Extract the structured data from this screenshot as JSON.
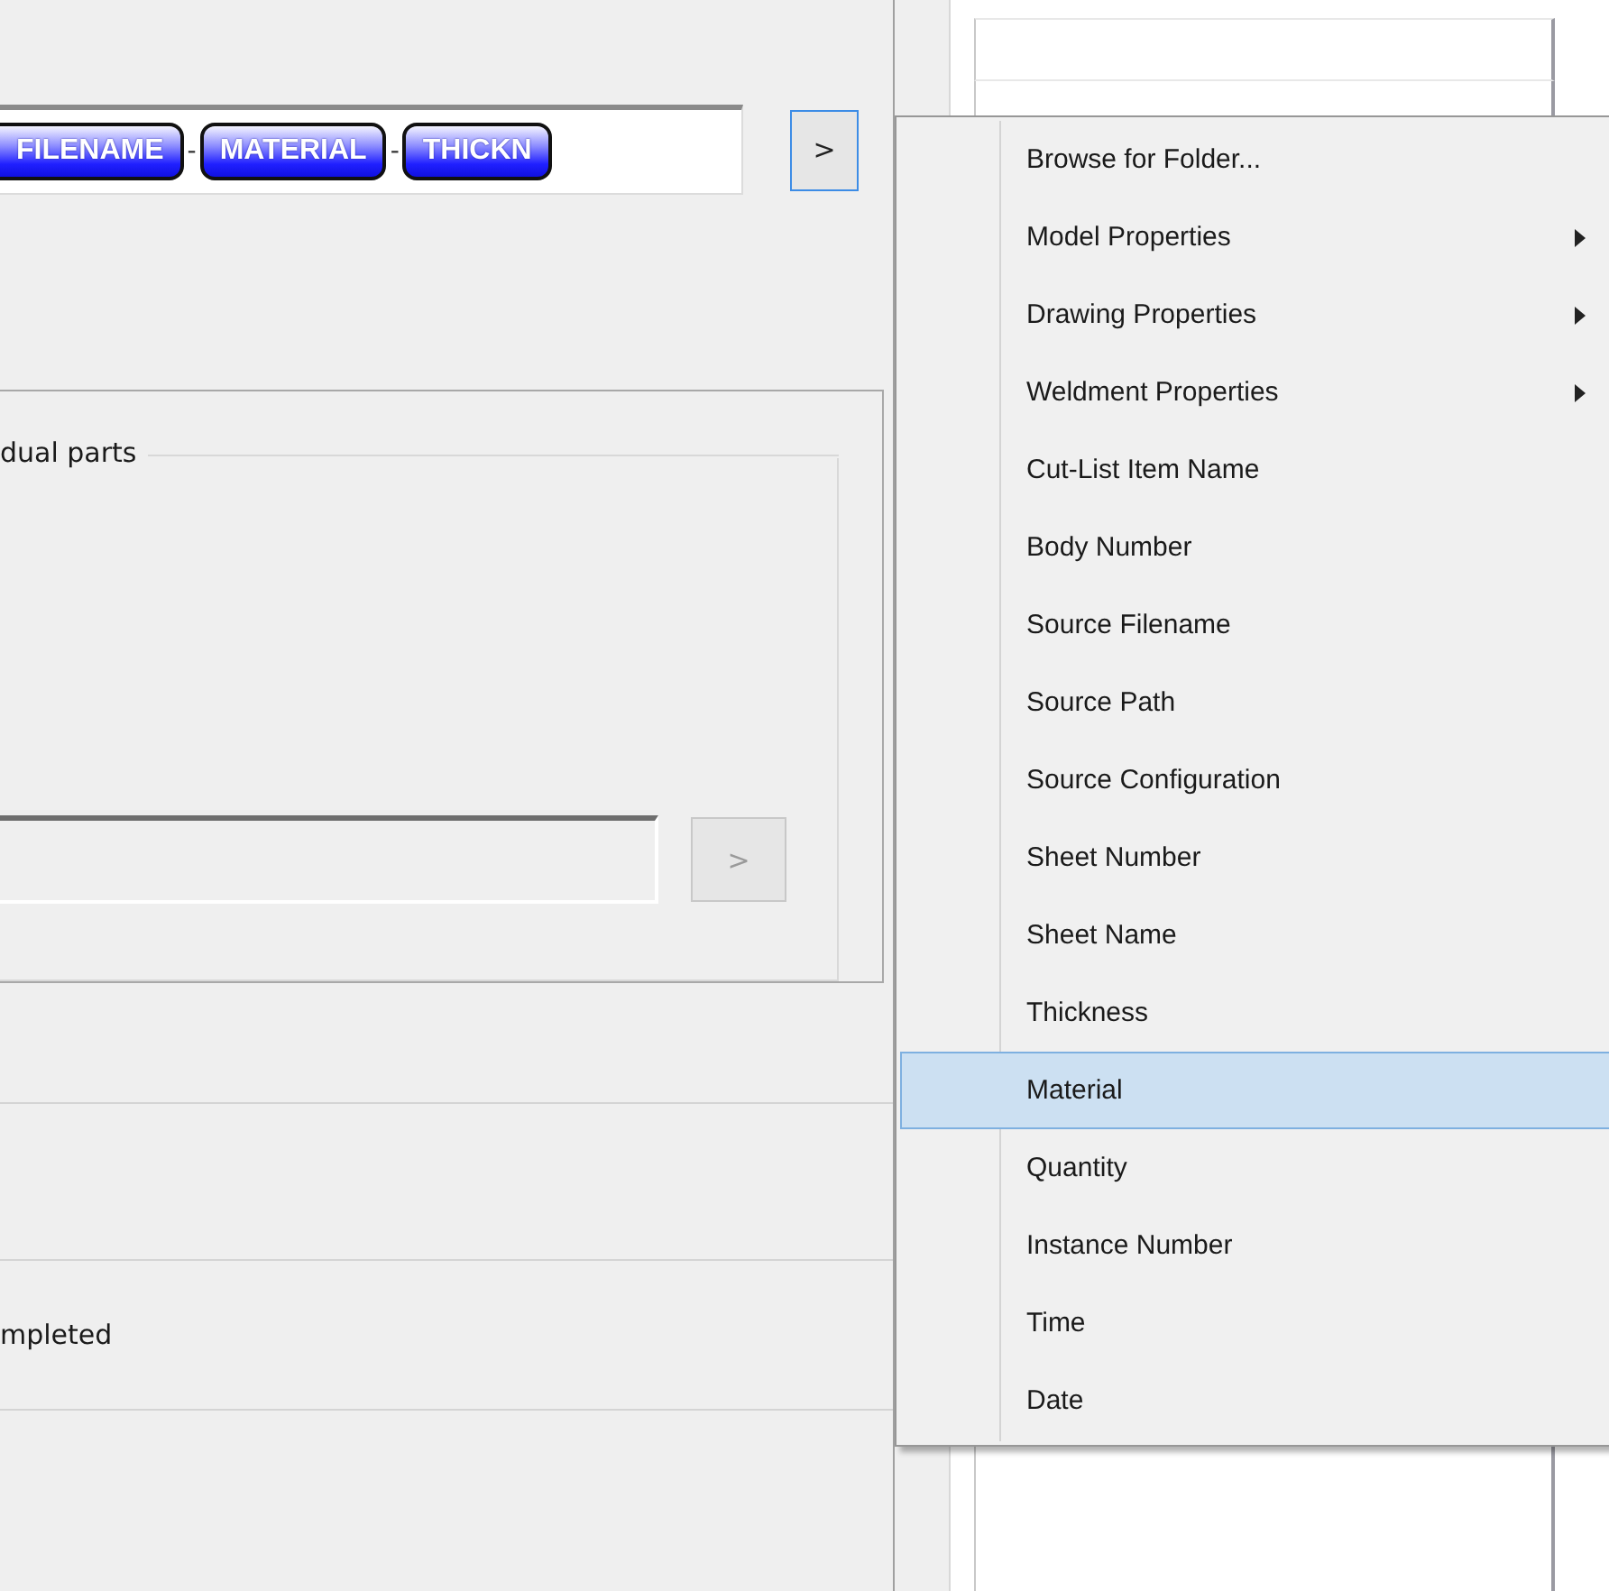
{
  "token_field": {
    "tokens": [
      {
        "text": "FILENAME",
        "cut_left": true
      },
      {
        "text": "MATERIAL",
        "cut_left": false
      },
      {
        "text": "THICKN",
        "cut_left": false
      }
    ],
    "separator": "-"
  },
  "insert_button": {
    "label": ">",
    "focused": true
  },
  "group": {
    "legend": "dual parts",
    "field_button": {
      "label": ">",
      "disabled": true
    }
  },
  "status_rows": [
    {
      "text": ""
    },
    {
      "text": "mpleted"
    },
    {
      "text": ""
    }
  ],
  "menu": {
    "items": [
      {
        "label": "Browse for Folder...",
        "submenu": false,
        "selected": false
      },
      {
        "label": "Model Properties",
        "submenu": true,
        "selected": false
      },
      {
        "label": "Drawing Properties",
        "submenu": true,
        "selected": false
      },
      {
        "label": "Weldment Properties",
        "submenu": true,
        "selected": false
      },
      {
        "label": "Cut-List Item Name",
        "submenu": false,
        "selected": false
      },
      {
        "label": "Body Number",
        "submenu": false,
        "selected": false
      },
      {
        "label": "Source Filename",
        "submenu": false,
        "selected": false
      },
      {
        "label": "Source Path",
        "submenu": false,
        "selected": false
      },
      {
        "label": "Source Configuration",
        "submenu": false,
        "selected": false
      },
      {
        "label": "Sheet Number",
        "submenu": false,
        "selected": false
      },
      {
        "label": "Sheet Name",
        "submenu": false,
        "selected": false
      },
      {
        "label": "Thickness",
        "submenu": false,
        "selected": false
      },
      {
        "label": "Material",
        "submenu": false,
        "selected": true
      },
      {
        "label": "Quantity",
        "submenu": false,
        "selected": false
      },
      {
        "label": "Instance Number",
        "submenu": false,
        "selected": false
      },
      {
        "label": "Time",
        "submenu": false,
        "selected": false
      },
      {
        "label": "Date",
        "submenu": false,
        "selected": false
      }
    ]
  }
}
